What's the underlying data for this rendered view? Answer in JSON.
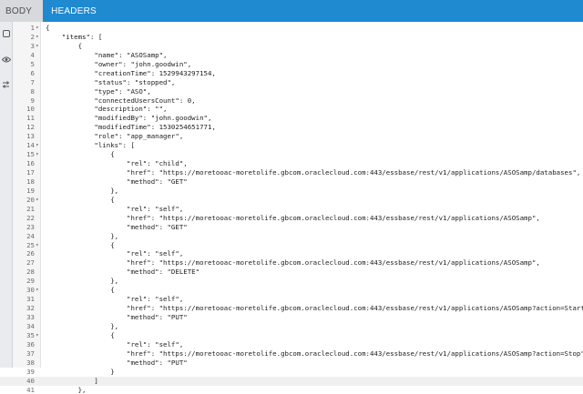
{
  "tabs": [
    {
      "label": "BODY",
      "active": false
    },
    {
      "label": "HEADERS",
      "active": true
    }
  ],
  "sidebar_icons": [
    "square-icon",
    "eye-icon",
    "swap-icon"
  ],
  "code_lines": [
    {
      "n": "1",
      "fold": true,
      "text": "{"
    },
    {
      "n": "2",
      "fold": true,
      "text": "    \"items\": ["
    },
    {
      "n": "3",
      "fold": true,
      "text": "        {"
    },
    {
      "n": "4",
      "fold": false,
      "text": "            \"name\": \"ASOSamp\","
    },
    {
      "n": "5",
      "fold": false,
      "text": "            \"owner\": \"john.goodwin\","
    },
    {
      "n": "6",
      "fold": false,
      "text": "            \"creationTime\": 1529943297154,"
    },
    {
      "n": "7",
      "fold": false,
      "text": "            \"status\": \"stopped\","
    },
    {
      "n": "8",
      "fold": false,
      "text": "            \"type\": \"ASO\","
    },
    {
      "n": "9",
      "fold": false,
      "text": "            \"connectedUsersCount\": 0,"
    },
    {
      "n": "10",
      "fold": false,
      "text": "            \"description\": \"\","
    },
    {
      "n": "11",
      "fold": false,
      "text": "            \"modifiedBy\": \"john.goodwin\","
    },
    {
      "n": "12",
      "fold": false,
      "text": "            \"modifiedTime\": 1530254651771,"
    },
    {
      "n": "13",
      "fold": false,
      "text": "            \"role\": \"app_manager\","
    },
    {
      "n": "14",
      "fold": true,
      "text": "            \"links\": ["
    },
    {
      "n": "15",
      "fold": true,
      "text": "                {"
    },
    {
      "n": "16",
      "fold": false,
      "text": "                    \"rel\": \"child\","
    },
    {
      "n": "17",
      "fold": false,
      "text": "                    \"href\": \"https://moretooac-moretolife.gbcom.oraclecloud.com:443/essbase/rest/v1/applications/ASOSamp/databases\","
    },
    {
      "n": "18",
      "fold": false,
      "text": "                    \"method\": \"GET\""
    },
    {
      "n": "19",
      "fold": false,
      "text": "                },"
    },
    {
      "n": "20",
      "fold": true,
      "text": "                {"
    },
    {
      "n": "21",
      "fold": false,
      "text": "                    \"rel\": \"self\","
    },
    {
      "n": "22",
      "fold": false,
      "text": "                    \"href\": \"https://moretooac-moretolife.gbcom.oraclecloud.com:443/essbase/rest/v1/applications/ASOSamp\","
    },
    {
      "n": "23",
      "fold": false,
      "text": "                    \"method\": \"GET\""
    },
    {
      "n": "24",
      "fold": false,
      "text": "                },"
    },
    {
      "n": "25",
      "fold": true,
      "text": "                {"
    },
    {
      "n": "26",
      "fold": false,
      "text": "                    \"rel\": \"self\","
    },
    {
      "n": "27",
      "fold": false,
      "text": "                    \"href\": \"https://moretooac-moretolife.gbcom.oraclecloud.com:443/essbase/rest/v1/applications/ASOSamp\","
    },
    {
      "n": "28",
      "fold": false,
      "text": "                    \"method\": \"DELETE\""
    },
    {
      "n": "29",
      "fold": false,
      "text": "                },"
    },
    {
      "n": "30",
      "fold": true,
      "text": "                {"
    },
    {
      "n": "31",
      "fold": false,
      "text": "                    \"rel\": \"self\","
    },
    {
      "n": "32",
      "fold": false,
      "text": "                    \"href\": \"https://moretooac-moretolife.gbcom.oraclecloud.com:443/essbase/rest/v1/applications/ASOSamp?action=Start\","
    },
    {
      "n": "33",
      "fold": false,
      "text": "                    \"method\": \"PUT\""
    },
    {
      "n": "34",
      "fold": false,
      "text": "                },"
    },
    {
      "n": "35",
      "fold": true,
      "text": "                {"
    },
    {
      "n": "36",
      "fold": false,
      "text": "                    \"rel\": \"self\","
    },
    {
      "n": "37",
      "fold": false,
      "text": "                    \"href\": \"https://moretooac-moretolife.gbcom.oraclecloud.com:443/essbase/rest/v1/applications/ASOSamp?action=Stop\","
    },
    {
      "n": "38",
      "fold": false,
      "text": "                    \"method\": \"PUT\""
    },
    {
      "n": "39",
      "fold": false,
      "text": "                }"
    },
    {
      "n": "40",
      "fold": false,
      "text": "            ]"
    },
    {
      "n": "41",
      "fold": false,
      "text": "        },"
    }
  ]
}
